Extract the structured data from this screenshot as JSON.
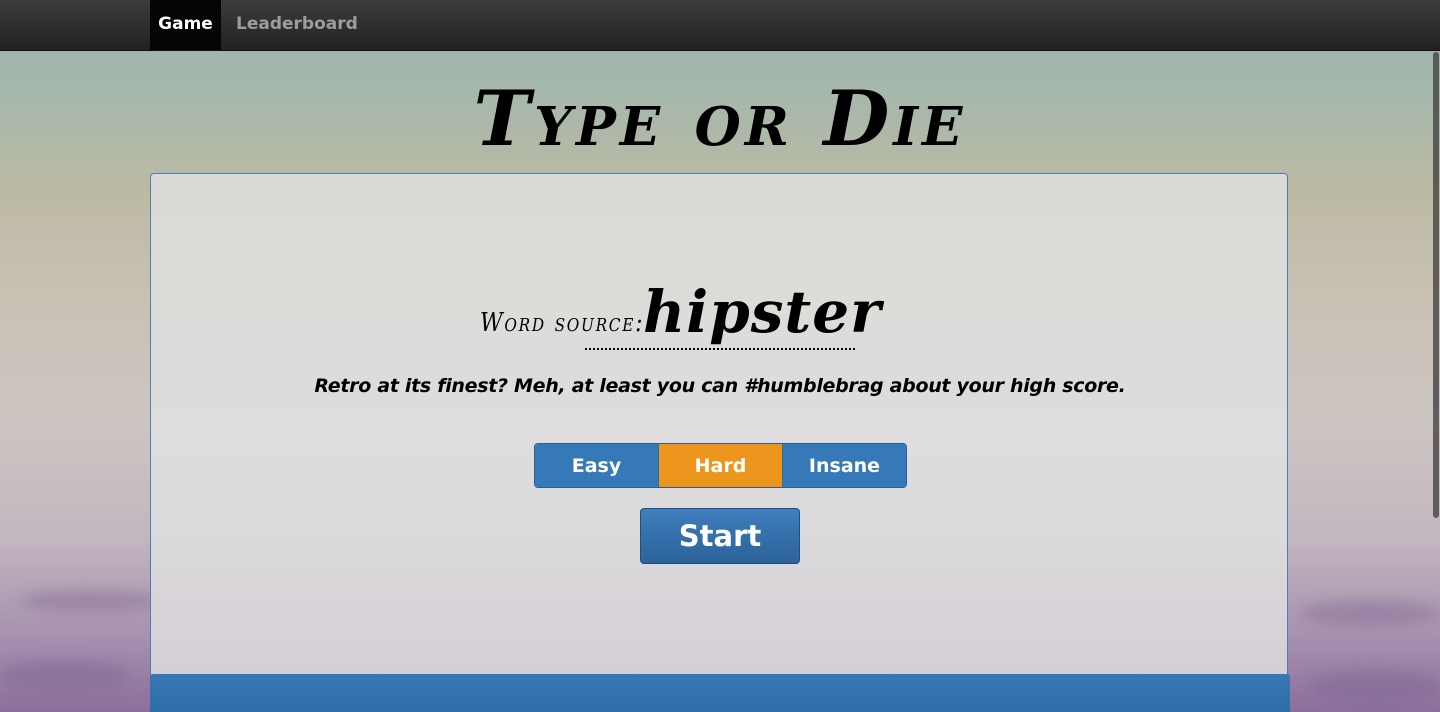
{
  "nav": {
    "items": [
      {
        "label": "Game",
        "active": true
      },
      {
        "label": "Leaderboard",
        "active": false
      }
    ]
  },
  "title": "Type or Die",
  "word_source": {
    "label": "Word source:",
    "value": "hipster"
  },
  "tagline": "Retro at its finest?  Meh, at least you can #humblebrag about your high score.",
  "difficulty": {
    "options": [
      "Easy",
      "Hard",
      "Insane"
    ],
    "selected": "Hard"
  },
  "start_label": "Start",
  "colors": {
    "primary": "#3579b8",
    "selected": "#ec961e",
    "navbar": "#222222"
  }
}
